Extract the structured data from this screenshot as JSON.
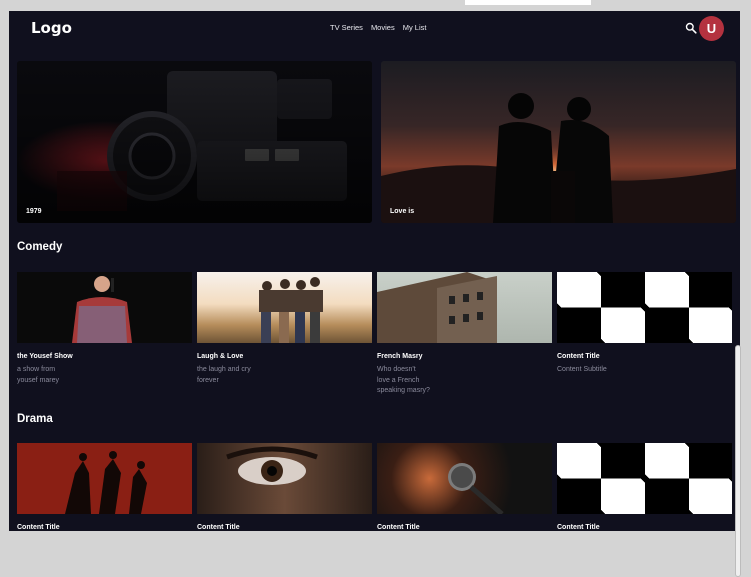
{
  "header": {
    "logo": "Logo",
    "nav": [
      "TV Series",
      "Movies",
      "My List"
    ],
    "avatar_initial": "U"
  },
  "hero": [
    {
      "label": "1979"
    },
    {
      "label": "Love is"
    }
  ],
  "sections": [
    {
      "title": "Comedy",
      "cards": [
        {
          "title": "the Yousef Show",
          "subtitle": "a show from\nyousef marey"
        },
        {
          "title": "Laugh & Love",
          "subtitle": "the laugh and cry\nforever"
        },
        {
          "title": "French Masry",
          "subtitle": "Who doesn't\nlove a French\nspeaking masry?"
        },
        {
          "title": "Content Title",
          "subtitle": "Content Subtitle"
        }
      ]
    },
    {
      "title": "Drama",
      "cards": [
        {
          "title": "Content Title"
        },
        {
          "title": "Content Title"
        },
        {
          "title": "Content Title"
        },
        {
          "title": "Content Title"
        }
      ]
    }
  ],
  "colors": {
    "background": "#10101e",
    "avatar": "#b4323f",
    "subtitle": "#8a8a9b"
  },
  "icons": [
    "search-icon",
    "avatar"
  ]
}
